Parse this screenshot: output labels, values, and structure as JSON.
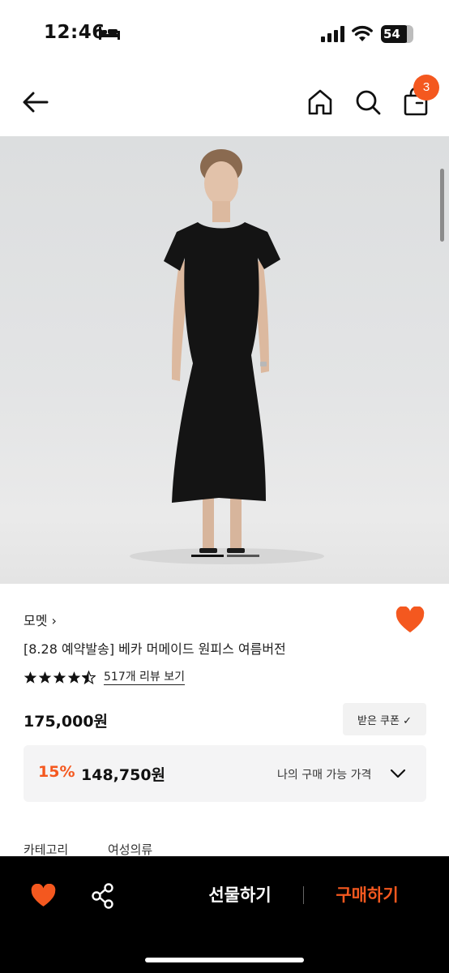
{
  "status": {
    "time": "12:46",
    "battery": "54"
  },
  "nav": {
    "cart_count": "3"
  },
  "product": {
    "brand": "모멧 ›",
    "title": "[8.28 예약발송] 베카 머메이드 원피스 여름버전",
    "rating": 4.5,
    "review_link": "517개 리뷰 보기",
    "price": "175,000원",
    "coupon_label": "받은 쿠폰 ✓",
    "discount_rate": "15%",
    "discount_price": "148,750원",
    "my_price_label": "나의 구매 가능 가격",
    "category_label": "카테고리",
    "category_value": "여성의류"
  },
  "bottom_bar": {
    "gift_label": "선물하기",
    "buy_label": "구매하기"
  },
  "colors": {
    "accent": "#f4581f",
    "bar_bg": "#000000"
  },
  "icons": [
    "back-arrow-icon",
    "home-icon",
    "search-icon",
    "bag-icon",
    "heart-icon",
    "star-icon",
    "chevron-down-icon",
    "share-icon",
    "bed-icon",
    "signal-icon",
    "wifi-icon",
    "battery-icon"
  ]
}
